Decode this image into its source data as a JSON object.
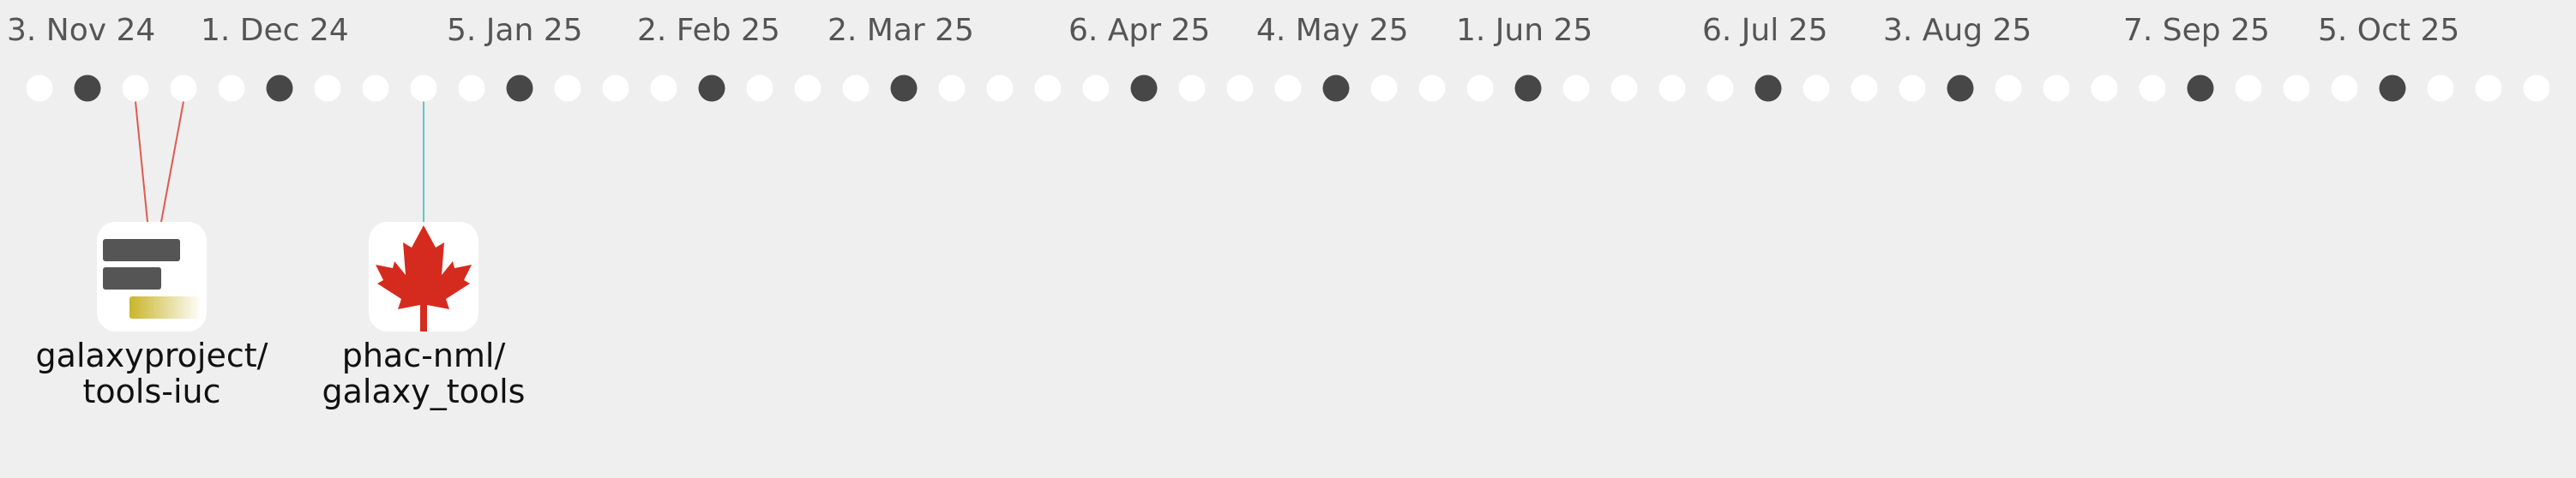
{
  "timeline": {
    "date_labels": [
      "3. Nov 24",
      "1. Dec 24",
      "5. Jan 25",
      "2. Feb 25",
      "2. Mar 25",
      "6. Apr 25",
      "4. May 25",
      "1. Jun 25",
      "6. Jul 25",
      "3. Aug 25",
      "7. Sep 25",
      "5. Oct 25"
    ],
    "week_count": 53,
    "filled_weeks": [
      1,
      5,
      10,
      14,
      18,
      23,
      27,
      31,
      36,
      40,
      45,
      49
    ],
    "colors": {
      "background": "#efefef",
      "dot_empty": "#ffffff",
      "dot_filled": "#474747",
      "link_galaxyproject": "#e05a4f",
      "link_phac": "#5bc9c7",
      "maple_leaf": "#d52b1e",
      "logo_bar": "#555555",
      "logo_gold": "#c9b52a"
    }
  },
  "repositories": [
    {
      "name_line1": "galaxyproject/",
      "name_line2": "tools-iuc",
      "icon": "galaxy-project-logo-icon",
      "linked_weeks": [
        2,
        3
      ]
    },
    {
      "name_line1": "phac-nml/",
      "name_line2": "galaxy_tools",
      "icon": "maple-leaf-icon",
      "linked_weeks": [
        8
      ]
    }
  ]
}
